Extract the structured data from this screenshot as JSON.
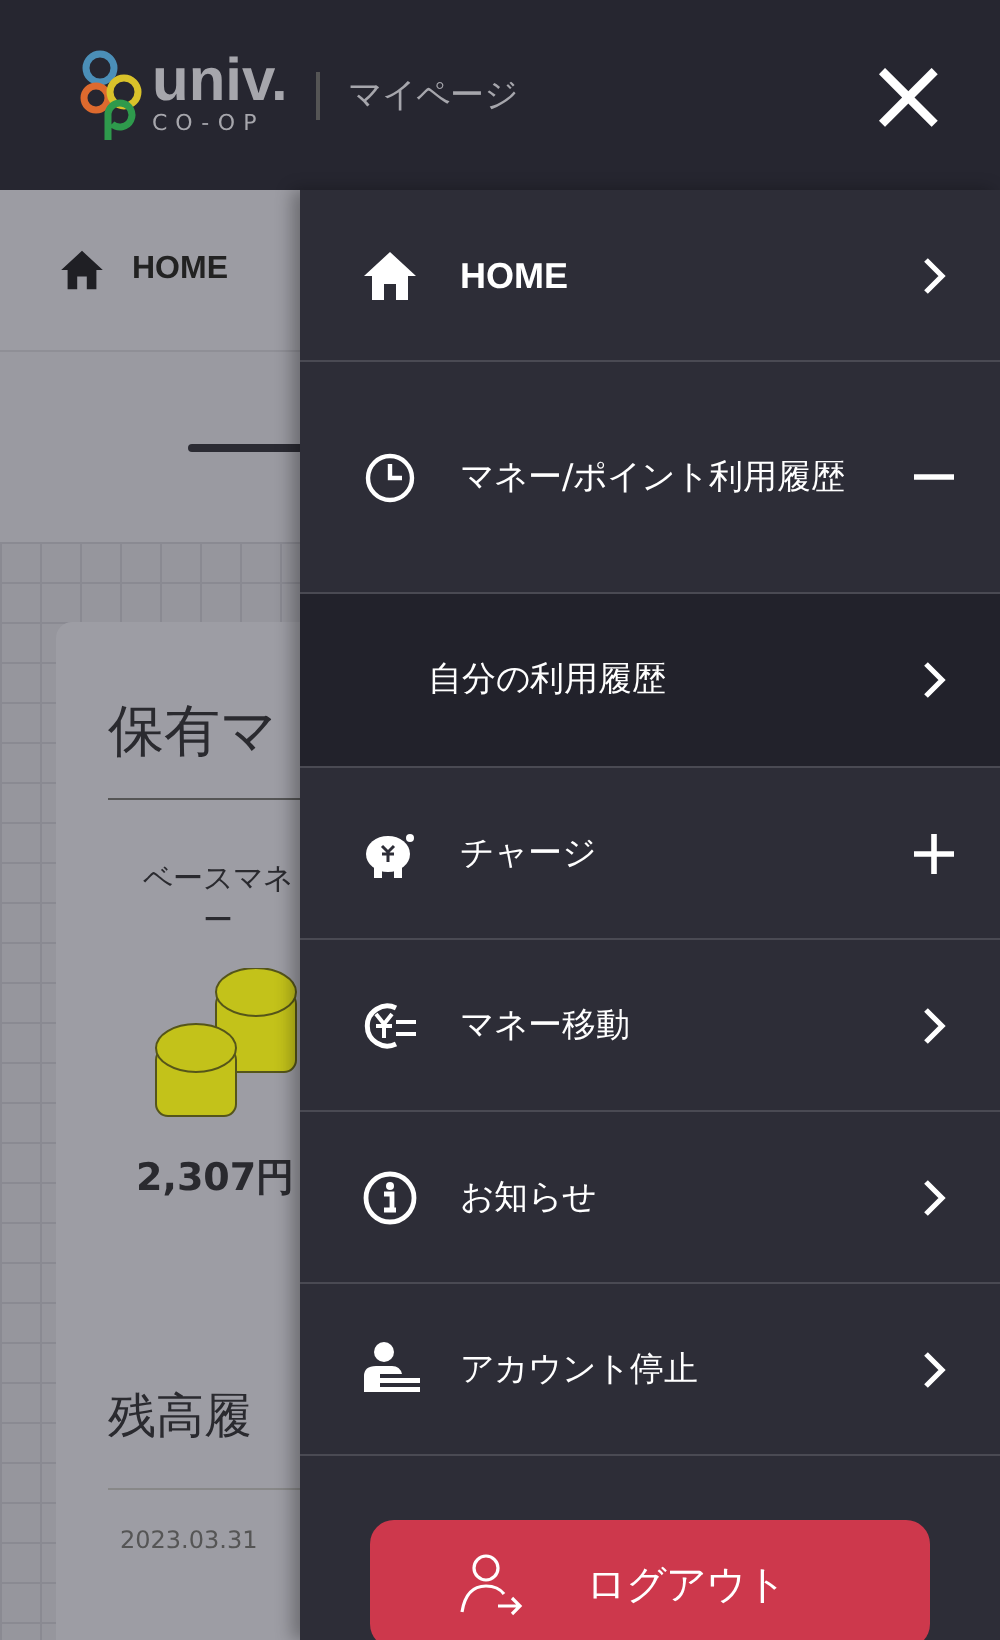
{
  "header": {
    "logo_main": "univ.",
    "logo_sub": "CO-OP",
    "title": "マイページ",
    "close": "×"
  },
  "page": {
    "breadcrumb": "HOME",
    "section_title": "保有マ",
    "money_label": "ベースマネ",
    "money_label_2": "ー",
    "amount": "2,307円",
    "history_title": "残高履",
    "history_date": "2023.03.31"
  },
  "menu": [
    {
      "kind": "link",
      "label": "HOME",
      "bold": true
    },
    {
      "kind": "group",
      "label": "マネー/ポイント利用履歴",
      "expanded": true,
      "children": [
        {
          "label": "自分の利用履歴"
        }
      ]
    },
    {
      "kind": "group",
      "label": "チャージ",
      "expanded": false
    },
    {
      "kind": "link",
      "label": "マネー移動",
      "bold": false
    },
    {
      "kind": "link",
      "label": "お知らせ",
      "bold": false
    },
    {
      "kind": "link",
      "label": "アカウント停止",
      "bold": false
    }
  ],
  "logout": {
    "label": "ログアウト"
  }
}
